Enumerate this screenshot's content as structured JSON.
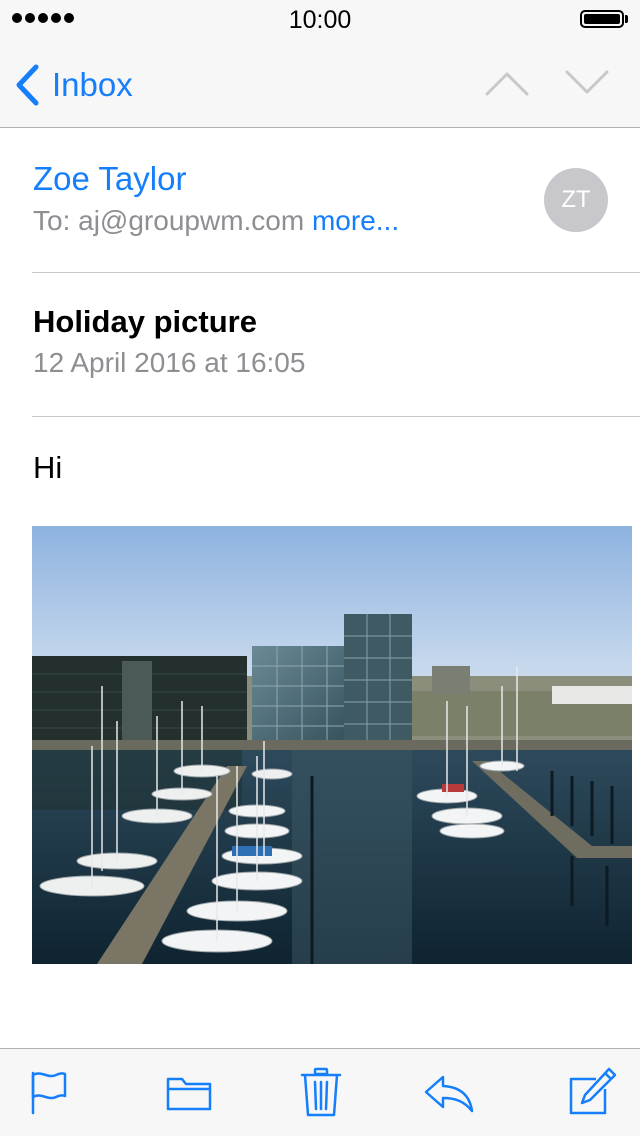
{
  "status_bar": {
    "time": "10:00",
    "signal_dots": 5,
    "battery_level": 1.0
  },
  "nav": {
    "back_label": "Inbox",
    "icons": [
      "chevron-left-icon",
      "chevron-up-icon",
      "chevron-down-icon"
    ]
  },
  "message": {
    "sender": "Zoe Taylor",
    "to_label": "To:",
    "to_address": "aj@groupwm.com",
    "more_link": "more...",
    "avatar_initials": "ZT",
    "subject": "Holiday picture",
    "date": "12 April 2016 at 16:05",
    "body": "Hi",
    "attachment": "harbour-marina-photo"
  },
  "toolbar": {
    "icons": [
      "flag-icon",
      "folder-icon",
      "trash-icon",
      "reply-icon",
      "compose-icon"
    ]
  },
  "colors": {
    "accent": "#157efb",
    "secondary_text": "#8e8e93",
    "avatar_bg": "#c8c7cc",
    "bar_bg": "#f7f7f7"
  }
}
